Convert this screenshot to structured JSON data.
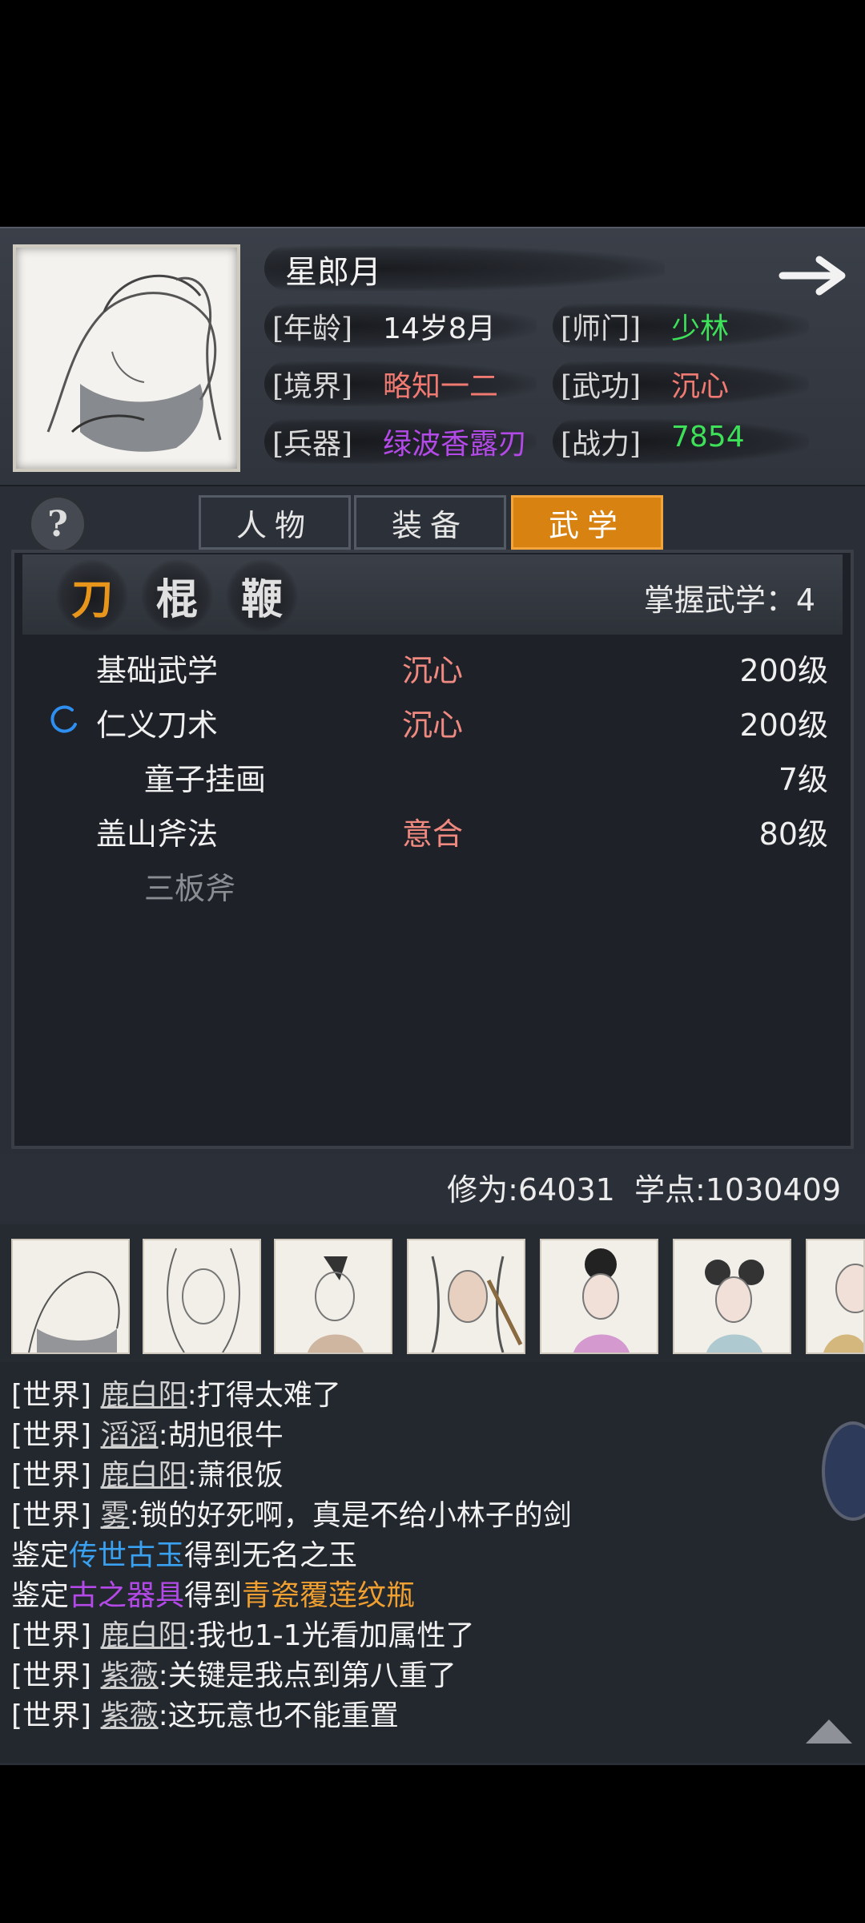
{
  "profile": {
    "name": "星郎月",
    "age_key": "[年龄]",
    "age_val": "14岁8月",
    "sect_key": "[师门]",
    "sect_val": "少林",
    "realm_key": "[境界]",
    "realm_val": "略知一二",
    "kungfu_key": "[武功]",
    "kungfu_val": "沉心",
    "weapon_key": "[兵器]",
    "weapon_val": "绿波香露刃",
    "power_key": "[战力]",
    "power_val": "7854"
  },
  "tabs": [
    {
      "label": "人物",
      "active": false
    },
    {
      "label": "装备",
      "active": false
    },
    {
      "label": "武学",
      "active": true
    }
  ],
  "help_label": "?",
  "categories": [
    "刀",
    "棍",
    "鞭"
  ],
  "mastered": "掌握武学：4",
  "skills": [
    {
      "name": "基础武学",
      "state": "沉心",
      "level": "200级"
    },
    {
      "name": "仁义刀术",
      "state": "沉心",
      "level": "200级"
    },
    {
      "name": "童子挂画",
      "state": "",
      "level": "7级"
    },
    {
      "name": "盖山斧法",
      "state": "意合",
      "level": "80级"
    },
    {
      "name": "三板斧",
      "state": "",
      "level": ""
    }
  ],
  "stats": {
    "cultivation": "修为:64031",
    "points": "学点:1030409"
  },
  "chat": [
    {
      "tag": "[世界]",
      "name": "鹿白阳",
      "msg": ":打得太难了"
    },
    {
      "tag": "[世界]",
      "name": "滔滔",
      "msg": ":胡旭很牛"
    },
    {
      "tag": "[世界]",
      "name": "鹿白阳",
      "msg": ":萧很饭"
    },
    {
      "tag": "[世界]",
      "name": "雾",
      "msg": ":锁的好死啊，真是不给小林子的剑"
    },
    {
      "pre": "鉴定",
      "item": "传世古玉",
      "mid": "得到",
      "result": "无名之玉"
    },
    {
      "pre": "鉴定",
      "item": "古之器具",
      "mid": "得到",
      "result": "青瓷覆莲纹瓶"
    },
    {
      "tag": "[世界]",
      "name": "鹿白阳",
      "msg": ":我也1-1光看加属性了"
    },
    {
      "tag": "[世界]",
      "name": "紫薇",
      "msg": ":关键是我点到第八重了"
    },
    {
      "tag": "[世界]",
      "name": "紫薇",
      "msg": ":这玩意也不能重置"
    }
  ],
  "colors": {
    "green": "#3ee05a",
    "red": "#f07a72",
    "purple": "#b34ae8",
    "orange_tab": "#d88211",
    "blue_item": "#3aa0f0",
    "purple_item": "#b34ae8",
    "orange_item": "#f0a030",
    "cat_active": "#e8951c"
  },
  "icons": [
    "next-arrow-icon",
    "loading-spinner-icon",
    "scroll-top-icon"
  ]
}
